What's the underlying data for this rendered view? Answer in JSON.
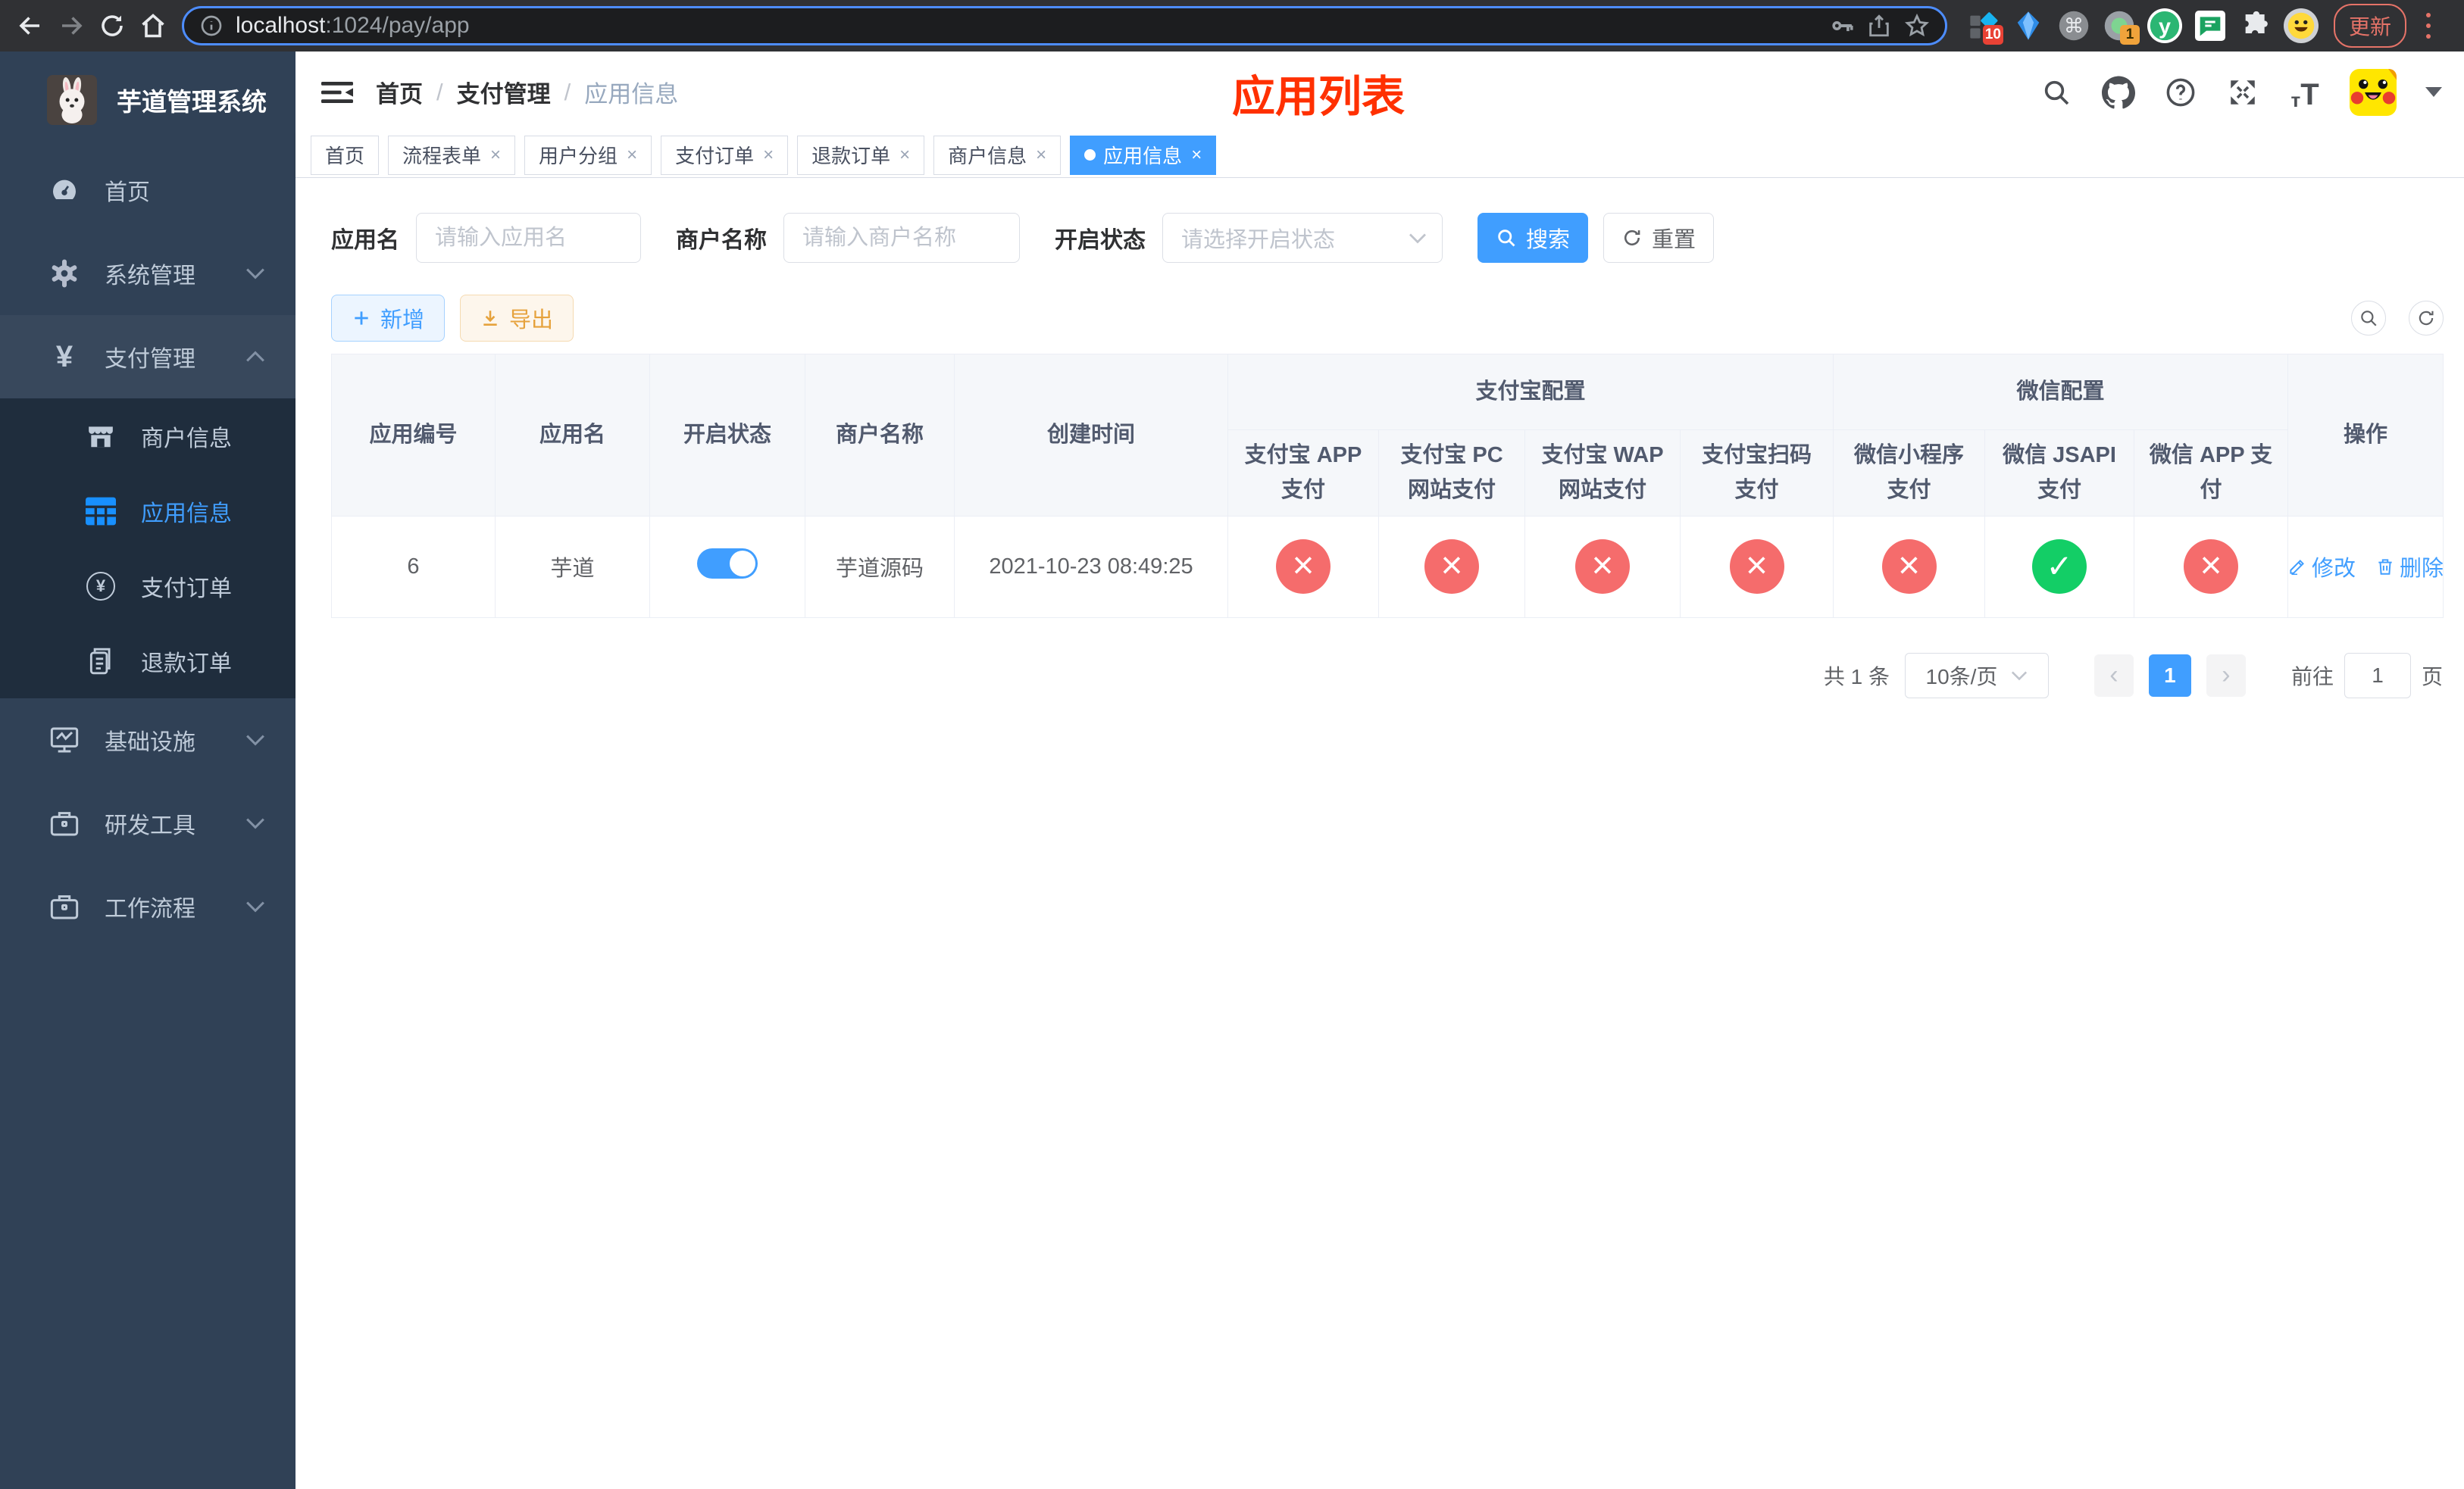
{
  "browser": {
    "url_host": "localhost",
    "url_path": ":1024/pay/app",
    "update_label": "更新",
    "extension_badge_puzzle_blue": "10",
    "extension_badge_green_dot": "1",
    "icons": [
      "back-icon",
      "forward-icon",
      "reload-icon",
      "home-icon",
      "info-icon",
      "key-icon",
      "share-icon",
      "star-icon",
      "puzzle-icon",
      "kebab-menu-icon"
    ]
  },
  "sidebar": {
    "title": "芋道管理系统",
    "items": [
      {
        "label": "首页",
        "icon": "dashboard-icon"
      },
      {
        "label": "系统管理",
        "icon": "gear-icon",
        "state": "collapsed"
      },
      {
        "label": "支付管理",
        "icon": "yen-icon",
        "state": "expanded"
      },
      {
        "label": "基础设施",
        "icon": "monitor-icon",
        "state": "collapsed"
      },
      {
        "label": "研发工具",
        "icon": "briefcase-icon",
        "state": "collapsed"
      },
      {
        "label": "工作流程",
        "icon": "briefcase-icon",
        "state": "collapsed"
      }
    ],
    "pay_children": [
      {
        "label": "商户信息",
        "icon": "shop-icon"
      },
      {
        "label": "应用信息",
        "icon": "grid-icon",
        "active": true
      },
      {
        "label": "支付订单",
        "icon": "yen-circle-icon"
      },
      {
        "label": "退款订单",
        "icon": "document-icon"
      }
    ]
  },
  "header": {
    "breadcrumb": [
      "首页",
      "支付管理",
      "应用信息"
    ],
    "breadcrumb_separator": "/",
    "page_title": "应用列表",
    "icons": [
      "search-icon",
      "github-icon",
      "help-icon",
      "fullscreen-icon",
      "font-size-icon",
      "avatar",
      "caret-down-icon"
    ]
  },
  "tabs": [
    {
      "label": "首页",
      "closable": false,
      "active": false
    },
    {
      "label": "流程表单",
      "closable": true,
      "active": false
    },
    {
      "label": "用户分组",
      "closable": true,
      "active": false
    },
    {
      "label": "支付订单",
      "closable": true,
      "active": false
    },
    {
      "label": "退款订单",
      "closable": true,
      "active": false
    },
    {
      "label": "商户信息",
      "closable": true,
      "active": false
    },
    {
      "label": "应用信息",
      "closable": true,
      "active": true
    }
  ],
  "filters": {
    "app_name_label": "应用名",
    "app_name_placeholder": "请输入应用名",
    "merchant_label": "商户名称",
    "merchant_placeholder": "请输入商户名称",
    "status_label": "开启状态",
    "status_placeholder": "请选择开启状态",
    "search_label": "搜索",
    "reset_label": "重置"
  },
  "toolbar": {
    "add_label": "新增",
    "export_label": "导出"
  },
  "table": {
    "columns": [
      "应用编号",
      "应用名",
      "开启状态",
      "商户名称",
      "创建时间"
    ],
    "groups": {
      "alipay": "支付宝配置",
      "wechat": "微信配置",
      "actions": "操作"
    },
    "sub_columns": [
      "支付宝 APP 支付",
      "支付宝 PC 网站支付",
      "支付宝 WAP 网站支付",
      "支付宝扫码支付",
      "微信小程序支付",
      "微信 JSAPI 支付",
      "微信 APP 支付"
    ],
    "rows": [
      {
        "id": "6",
        "name": "芋道",
        "enabled": "on",
        "merchant": "芋道源码",
        "created": "2021-10-23 08:49:25",
        "alipay_app": "fail",
        "alipay_pc": "fail",
        "alipay_wap": "fail",
        "alipay_qr": "fail",
        "wx_lite": "fail",
        "wx_jsapi": "success",
        "wx_app": "fail",
        "edit_label": "修改",
        "delete_label": "删除"
      }
    ]
  },
  "pagination": {
    "total": "共 1 条",
    "page_size": "10条/页",
    "prev": "‹",
    "next": "›",
    "current": "1",
    "goto_prefix": "前往",
    "goto_value": "1",
    "goto_suffix": "页"
  },
  "colors": {
    "accent": "#409eff",
    "danger": "#f56c6c",
    "success": "#13ce66",
    "warning": "#e6a23c",
    "title_red": "#ff3000",
    "sidebar_bg": "#304156",
    "submenu_bg": "#1f2d3d"
  }
}
